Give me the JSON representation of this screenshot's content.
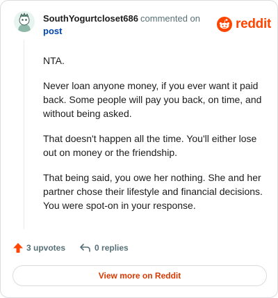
{
  "comment": {
    "username": "SouthYogurtcloset686",
    "action": "commented on",
    "target": "post",
    "paragraphs": [
      "NTA.",
      "Never loan anyone money, if you ever want it paid back. Some people will pay you back, on time, and without being asked.",
      "That doesn't happen all the time. You'll either lose out on money or the friendship.",
      "That being said, you owe her nothing. She and her partner chose their lifestyle and financial decisions. You were spot-on in your response."
    ]
  },
  "brand": {
    "name": "reddit",
    "color": "#ff4500",
    "icon": "reddit-snoo-icon"
  },
  "actions": {
    "upvotes": "3 upvotes",
    "replies": "0 replies",
    "upvote_icon": "upvote-arrow-icon",
    "reply_icon": "reply-arrow-icon"
  },
  "footer": {
    "view_button": "View more on Reddit"
  }
}
